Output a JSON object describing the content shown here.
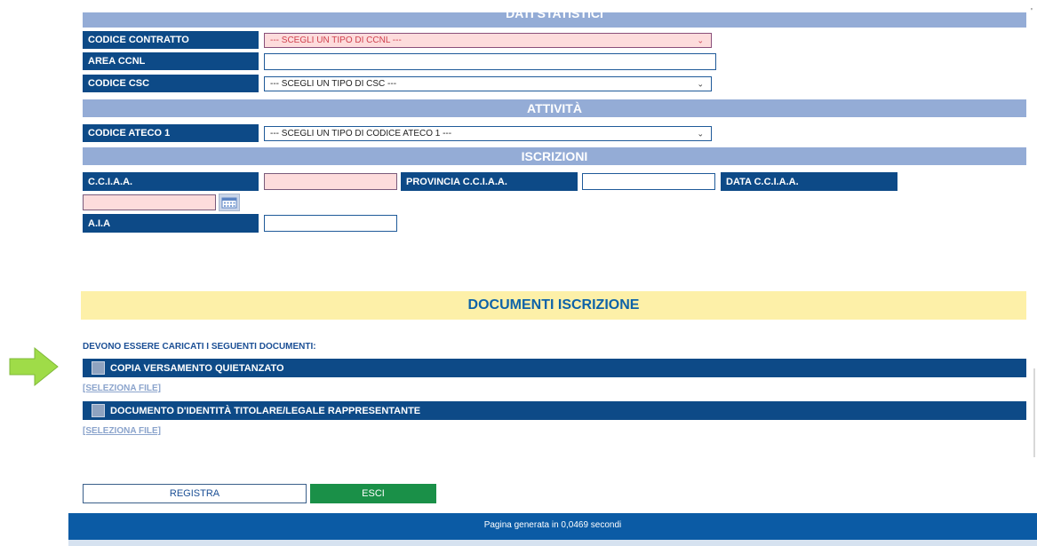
{
  "sections": {
    "dati_statistici": "DATI STATISTICI",
    "attivita": "ATTIVITÀ",
    "iscrizioni": "ISCRIZIONI"
  },
  "fields": {
    "codice_contratto": {
      "label": "CODICE CONTRATTO",
      "value": "--- SCEGLI UN TIPO DI CCNL ---"
    },
    "area_ccnl": {
      "label": "AREA CCNL",
      "value": ""
    },
    "codice_csc": {
      "label": "CODICE CSC",
      "value": "--- SCEGLI UN TIPO DI CSC ---"
    },
    "codice_ateco_1": {
      "label": "CODICE ATECO 1",
      "value": "--- SCEGLI UN TIPO DI CODICE ATECO 1 ---"
    },
    "cciaa": {
      "label": "C.C.I.A.A.",
      "value": ""
    },
    "provincia_cciaa": {
      "label": "PROVINCIA C.C.I.A.A.",
      "value": ""
    },
    "data_cciaa": {
      "label": "DATA C.C.I.A.A.",
      "value": ""
    },
    "aia": {
      "label": "A.I.A",
      "value": ""
    }
  },
  "documenti": {
    "title": "DOCUMENTI ISCRIZIONE",
    "intro": "DEVONO ESSERE CARICATI I SEGUENTI DOCUMENTI:",
    "items": [
      {
        "label": "COPIA VERSAMENTO QUIETANZATO",
        "link": "[SELEZIONA FILE]"
      },
      {
        "label": "DOCUMENTO D'IDENTITÀ TITOLARE/LEGALE RAPPRESENTANTE",
        "link": "[SELEZIONA FILE]"
      }
    ]
  },
  "buttons": {
    "registra": "REGISTRA",
    "esci": "ESCI"
  },
  "footer": {
    "text": "Pagina generata in 0,0469 secondi"
  },
  "icons": {
    "calendar": "calendar-icon",
    "arrow": "green-right-arrow-icon",
    "chevron": "chevron-down-icon"
  },
  "colors": {
    "label_bg": "#0d4a87",
    "section_bg": "#94acd6",
    "required_field_bg": "#fddcdc",
    "doc_title_bg": "#fdf0a8",
    "esci_bg": "#1a9048",
    "footer_bg": "#0b5ba5"
  }
}
